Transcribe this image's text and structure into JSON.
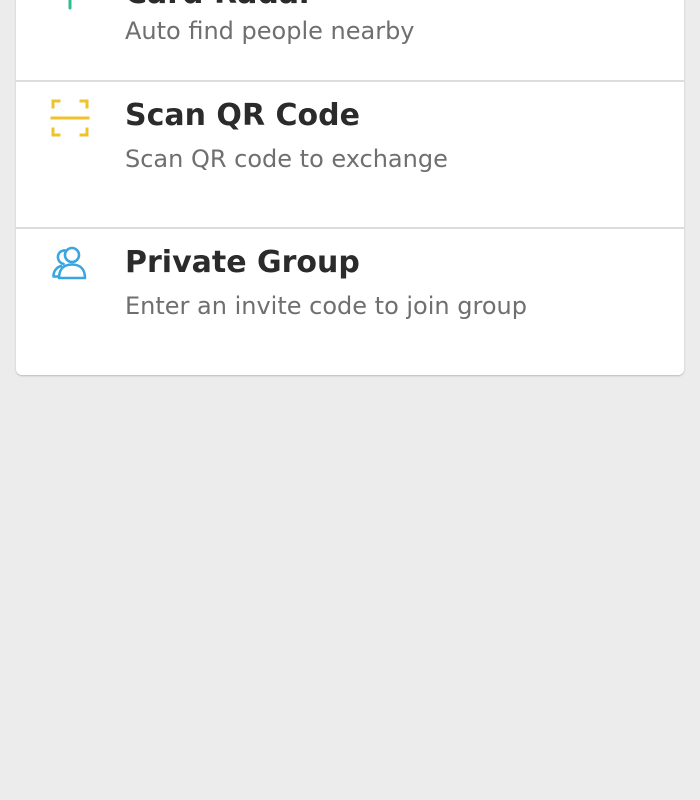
{
  "menu": {
    "items": [
      {
        "title": "Card Radar",
        "subtitle": "Auto find people nearby",
        "icon": "radar-icon",
        "icon_color": "#2fbf8f"
      },
      {
        "title": "Scan QR Code",
        "subtitle": "Scan QR code to exchange",
        "icon": "scan-qr-icon",
        "icon_color": "#f2c12e"
      },
      {
        "title": "Private Group",
        "subtitle": "Enter an invite code to join group",
        "icon": "group-icon",
        "icon_color": "#3aa6e0"
      }
    ]
  },
  "colors": {
    "background": "#ececec",
    "card": "#ffffff",
    "title": "#2b2b2b",
    "subtitle": "#6f6f6f",
    "divider": "#dcdcdc"
  }
}
